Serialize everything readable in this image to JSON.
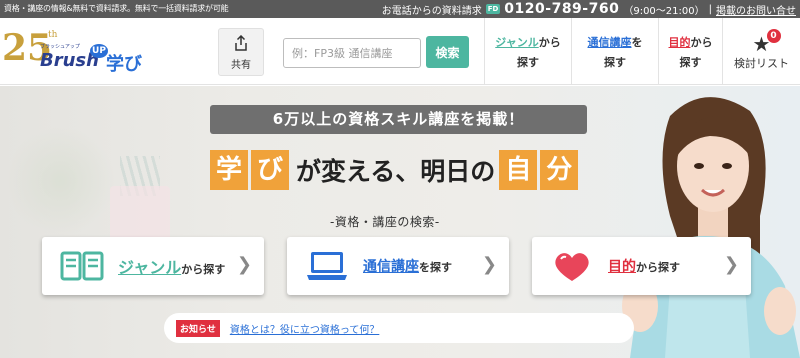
{
  "topbar": {
    "tagline": "資格・講座の情報&無料で資料請求。無料で一括資料請求が可能",
    "phone_label": "お電話からの資料請求",
    "freedial_badge": "FD",
    "phone": "0120-789-760",
    "hours": "（9:00～21:00）",
    "separator": "|",
    "listing_link": "掲載のお問い合せ"
  },
  "logo": {
    "anniversary": "25",
    "anniversary_suffix": "th",
    "kana": "ブラッシュアップ",
    "brush": "Brush",
    "up": "UP",
    "manabi": "学び"
  },
  "header": {
    "share_label": "共有",
    "search_placeholder": "例：FP3級 通信講座",
    "search_button": "検索",
    "nav": [
      {
        "keyword": "ジャンル",
        "suffix": "から",
        "line2": "探す"
      },
      {
        "keyword": "通信講座",
        "suffix": "を",
        "line2": "探す"
      },
      {
        "keyword": "目的",
        "suffix": "から",
        "line2": "探す"
      }
    ],
    "list": {
      "label": "検討リスト",
      "count": "0"
    }
  },
  "hero": {
    "banner": "6万以上の資格スキル講座を掲載！",
    "catch": {
      "box1": "学",
      "box2": "び",
      "mid": "が変える、明日の",
      "box3": "自",
      "box4": "分"
    },
    "subhead": "-資格・講座の検索-",
    "categories": [
      {
        "keyword": "ジャンル",
        "suffix": "から探す",
        "icon": "book-icon",
        "color": "#4db6a0"
      },
      {
        "keyword": "通信講座",
        "suffix": "を探す",
        "icon": "laptop-icon",
        "color": "#2a6fd6"
      },
      {
        "keyword": "目的",
        "suffix": "から探す",
        "icon": "heart-icon",
        "color": "#e0303f"
      }
    ],
    "news": {
      "badge": "お知らせ",
      "link": "資格とは？役に立つ資格って何？"
    }
  },
  "colors": {
    "accent_green": "#4db6a0",
    "accent_blue": "#2a6fd6",
    "accent_red": "#e0303f",
    "accent_orange": "#f0a23a",
    "topbar": "#5a5a5a"
  }
}
